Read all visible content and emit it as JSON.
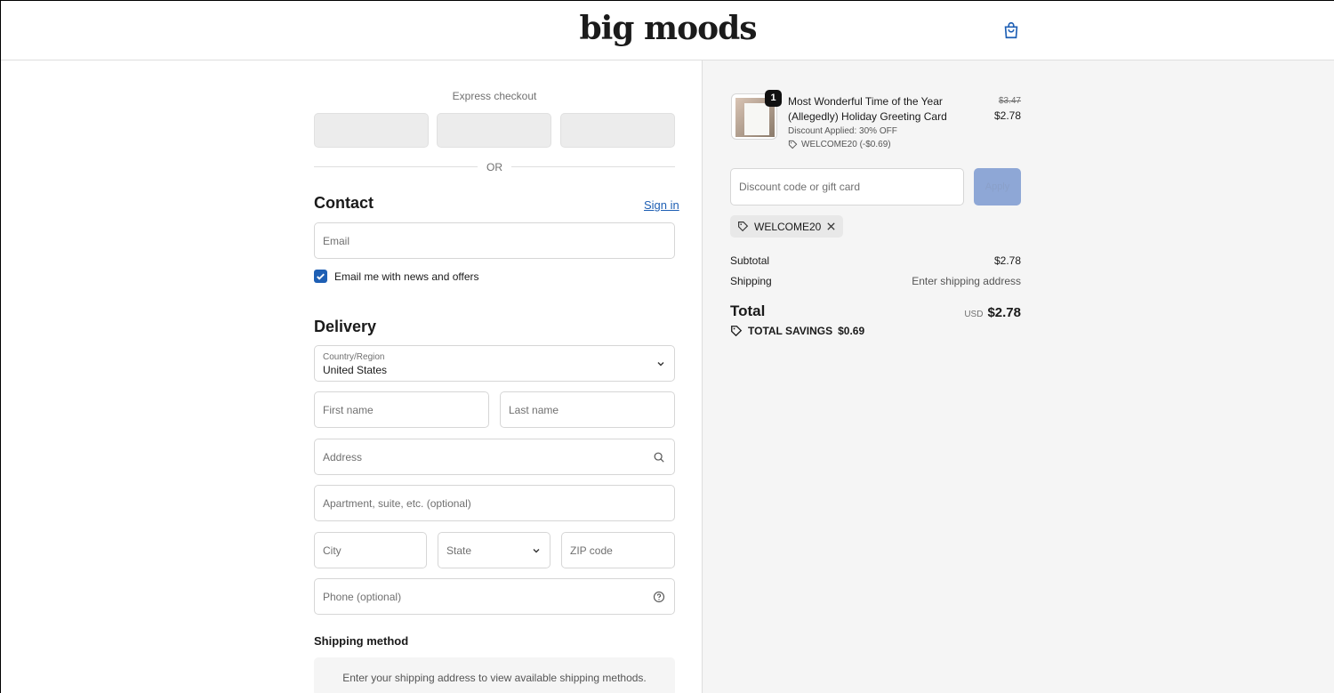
{
  "header": {
    "logo_text": "big moods",
    "cart_icon": "shopping-bag-icon"
  },
  "express": {
    "label": "Express checkout",
    "or_text": "OR"
  },
  "contact": {
    "heading": "Contact",
    "sign_in": "Sign in",
    "email_placeholder": "Email",
    "newsletter_label": "Email me with news and offers",
    "newsletter_checked": true
  },
  "delivery": {
    "heading": "Delivery",
    "country_label": "Country/Region",
    "country_value": "United States",
    "first_name": "First name",
    "last_name": "Last name",
    "address": "Address",
    "apartment": "Apartment, suite, etc. (optional)",
    "city": "City",
    "state": "State",
    "zip": "ZIP code",
    "phone": "Phone (optional)"
  },
  "shipping_method": {
    "heading": "Shipping method",
    "message": "Enter your shipping address to view available shipping methods."
  },
  "order": {
    "item": {
      "quantity": "1",
      "title": "Most Wonderful Time of the Year (Allegedly) Holiday Greeting Card",
      "discount_applied": "Discount Applied: 30% OFF",
      "code_line": "WELCOME20 (-$0.69)",
      "price_original": "$3.47",
      "price_final": "$2.78"
    },
    "discount_placeholder": "Discount code or gift card",
    "apply_label": "Apply",
    "applied_code": "WELCOME20",
    "subtotal_label": "Subtotal",
    "subtotal_value": "$2.78",
    "shipping_label": "Shipping",
    "shipping_value": "Enter shipping address",
    "total_label": "Total",
    "currency": "USD",
    "total_value": "$2.78",
    "savings_label": "TOTAL SAVINGS",
    "savings_value": "$0.69"
  },
  "colors": {
    "accent": "#1e5fb4",
    "apply_button": "#8ea7d6",
    "summary_bg": "#f5f5f5"
  }
}
